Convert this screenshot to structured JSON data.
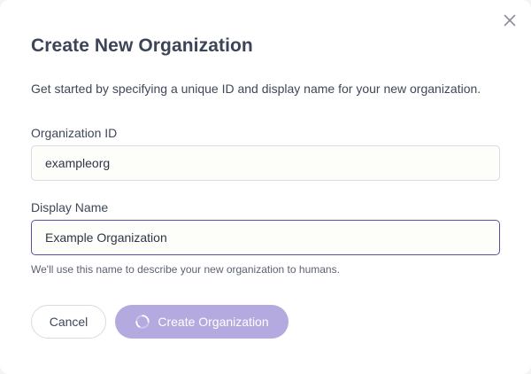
{
  "dialog": {
    "title": "Create New Organization",
    "subtitle": "Get started by specifying a unique ID and display name for your new organization.",
    "close_icon": "close-icon"
  },
  "fields": {
    "org_id": {
      "label": "Organization ID",
      "value": "exampleorg"
    },
    "display_name": {
      "label": "Display Name",
      "value": "Example Organization",
      "hint": "We'll use this name to describe your new organization to humans."
    }
  },
  "actions": {
    "cancel_label": "Cancel",
    "create_label": "Create Organization",
    "create_loading": true,
    "spinner_icon": "spinner-icon"
  },
  "colors": {
    "accent": "#5a4fa3",
    "button_disabled": "#b4aadf",
    "text": "#3c4457"
  }
}
